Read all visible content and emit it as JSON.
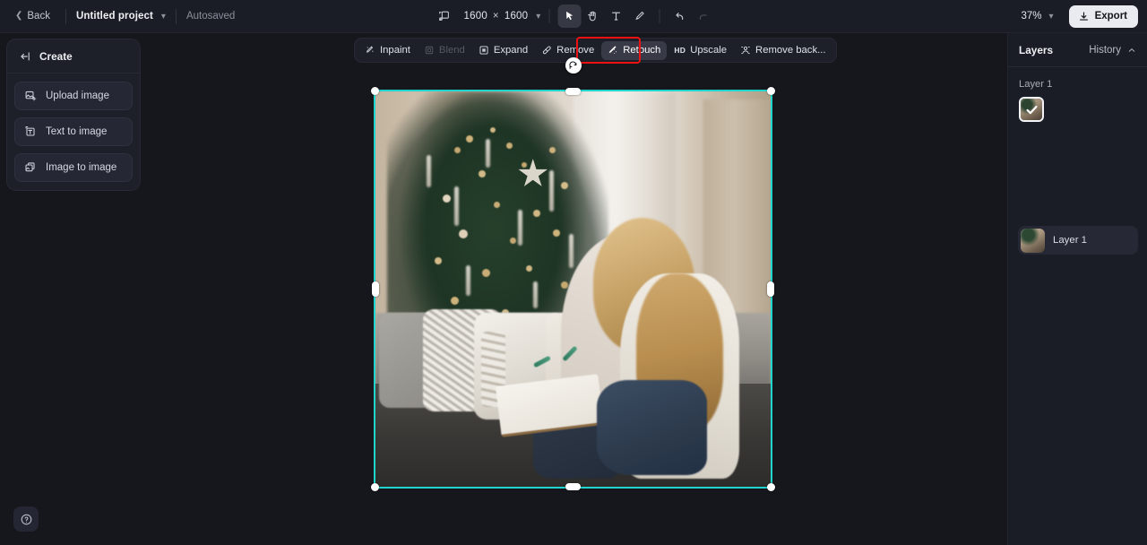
{
  "topbar": {
    "back_label": "Back",
    "project_name": "Untitled project",
    "project_caret_icon": "chevron-down-icon",
    "autosaved_label": "Autosaved",
    "canvas_size_icon": "canvas-resize-icon",
    "canvas_width": "1600",
    "canvas_size_separator": "×",
    "canvas_height": "1600",
    "size_caret_icon": "chevron-down-icon",
    "tools": [
      {
        "name": "select-tool",
        "icon": "cursor-arrow-icon",
        "active": true,
        "disabled": false
      },
      {
        "name": "hand-tool",
        "icon": "hand-icon",
        "active": false,
        "disabled": false
      },
      {
        "name": "text-tool",
        "icon": "text-t-icon",
        "active": false,
        "disabled": false
      },
      {
        "name": "brush-tool",
        "icon": "brush-icon",
        "active": false,
        "disabled": false
      }
    ],
    "undo_icon": "undo-arrow-icon",
    "redo_icon": "redo-arrow-icon",
    "zoom_level": "37%",
    "zoom_caret_icon": "chevron-down-icon",
    "export_label": "Export",
    "export_icon": "download-icon"
  },
  "create_panel": {
    "collapse_icon": "collapse-left-icon",
    "title": "Create",
    "items": [
      {
        "label": "Upload image",
        "icon": "upload-image-icon"
      },
      {
        "label": "Text to image",
        "icon": "text-to-image-icon"
      },
      {
        "label": "Image to image",
        "icon": "image-to-image-icon"
      }
    ]
  },
  "subbar": {
    "items": [
      {
        "label": "Inpaint",
        "icon": "magic-wand-icon",
        "state": "normal"
      },
      {
        "label": "Blend",
        "icon": "blend-square-icon",
        "state": "disabled"
      },
      {
        "label": "Expand",
        "icon": "expand-frame-icon",
        "state": "normal"
      },
      {
        "label": "Remove",
        "icon": "eraser-icon",
        "state": "normal"
      },
      {
        "label": "Retouch",
        "icon": "retouch-wand-icon",
        "state": "active"
      },
      {
        "label": "Upscale",
        "icon": "hd-badge-icon",
        "state": "normal"
      },
      {
        "label": "Remove back...",
        "icon": "remove-background-icon",
        "state": "normal"
      }
    ],
    "highlight_color": "#ee1111",
    "highlighted_item": "Retouch"
  },
  "canvas": {
    "selection_color": "#1fd6cf",
    "rotate_handle_icon": "rotate-icon",
    "background_color": "#16171d",
    "image_description": "Woman and child sitting on a grey couch with pillows in front of a decorated Christmas tree"
  },
  "layers_panel": {
    "title": "Layers",
    "history_label": "History",
    "history_caret_icon": "chevron-up-icon",
    "active_layer_label": "Layer 1",
    "selected_check_icon": "check-icon",
    "rows": [
      {
        "label": "Layer 1",
        "thumb": "layer-thumbnail"
      }
    ]
  },
  "help": {
    "icon": "question-mark-icon"
  }
}
